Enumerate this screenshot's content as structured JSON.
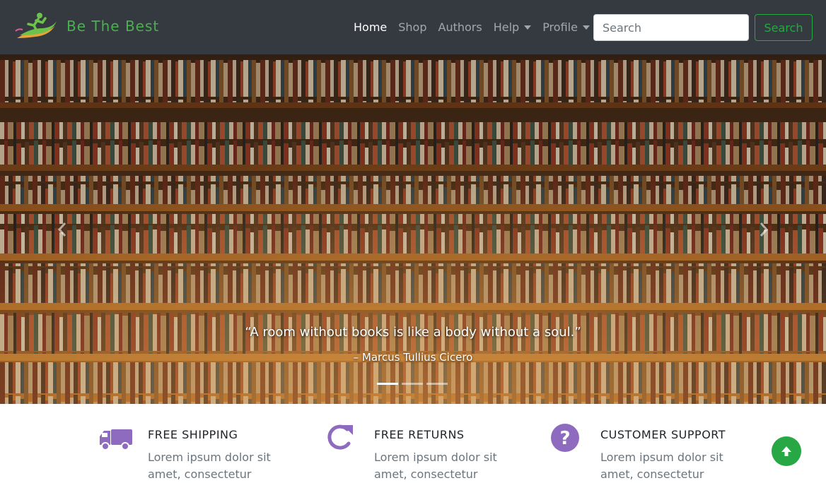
{
  "brand": {
    "name": "Be The Best",
    "logo": "runner-logo"
  },
  "nav": {
    "items": [
      {
        "label": "Home",
        "active": true,
        "dropdown": false
      },
      {
        "label": "Shop",
        "active": false,
        "dropdown": false
      },
      {
        "label": "Authors",
        "active": false,
        "dropdown": false
      },
      {
        "label": "Help",
        "active": false,
        "dropdown": true
      },
      {
        "label": "Profile",
        "active": false,
        "dropdown": true
      }
    ]
  },
  "search": {
    "placeholder": "Search",
    "value": "",
    "button_label": "Search"
  },
  "carousel": {
    "quote": "“A room without books is like a body without a soul.”",
    "author": "– Marcus Tullius Cicero",
    "slide_count": 3,
    "active_slide": 0,
    "prev_icon": "chevron-left-icon",
    "next_icon": "chevron-right-icon"
  },
  "features": [
    {
      "icon": "truck-icon",
      "title": "FREE SHIPPING",
      "text": "Lorem ipsum dolor sit amet, consectetur"
    },
    {
      "icon": "redo-icon",
      "title": "FREE RETURNS",
      "text": "Lorem ipsum dolor sit amet, consectetur"
    },
    {
      "icon": "question-circle-icon",
      "title": "CUSTOMER SUPPORT",
      "text": "Lorem ipsum dolor sit amet, consectetur"
    }
  ],
  "back_to_top_icon": "arrow-up-icon",
  "colors": {
    "navbar": "#343a40",
    "brand": "#4caf50",
    "accent": "#28a745",
    "icon_purple": "#8e6bbf"
  }
}
